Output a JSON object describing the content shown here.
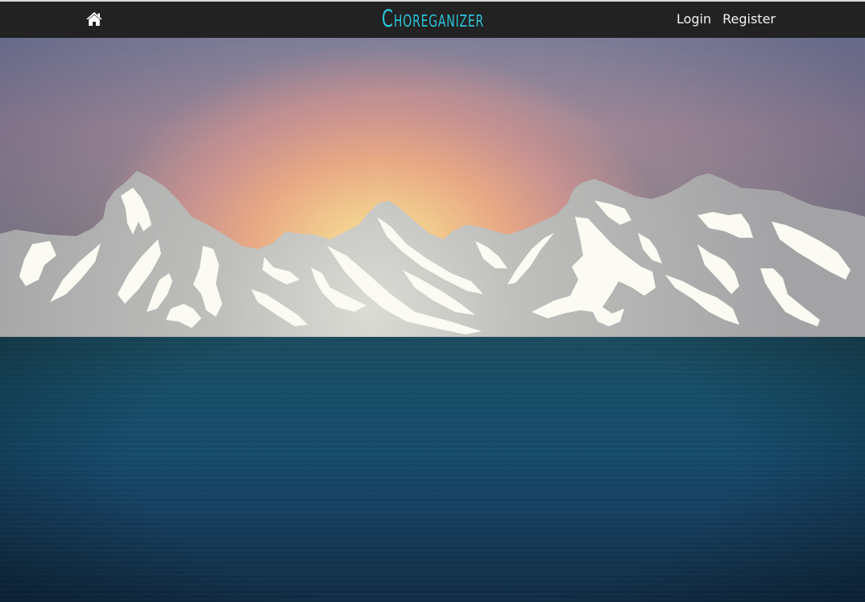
{
  "navbar": {
    "home_icon": "home-icon",
    "brand": "Choreganizer",
    "links": [
      {
        "label": "Login"
      },
      {
        "label": "Register"
      }
    ]
  },
  "colors": {
    "navbar_bg": "#222222",
    "brand": "#2bc3d9",
    "nav_link": "#f2f2f2",
    "water": "#154a6b",
    "mountain": "#a8a8a8",
    "snow": "#f8f8f0"
  }
}
